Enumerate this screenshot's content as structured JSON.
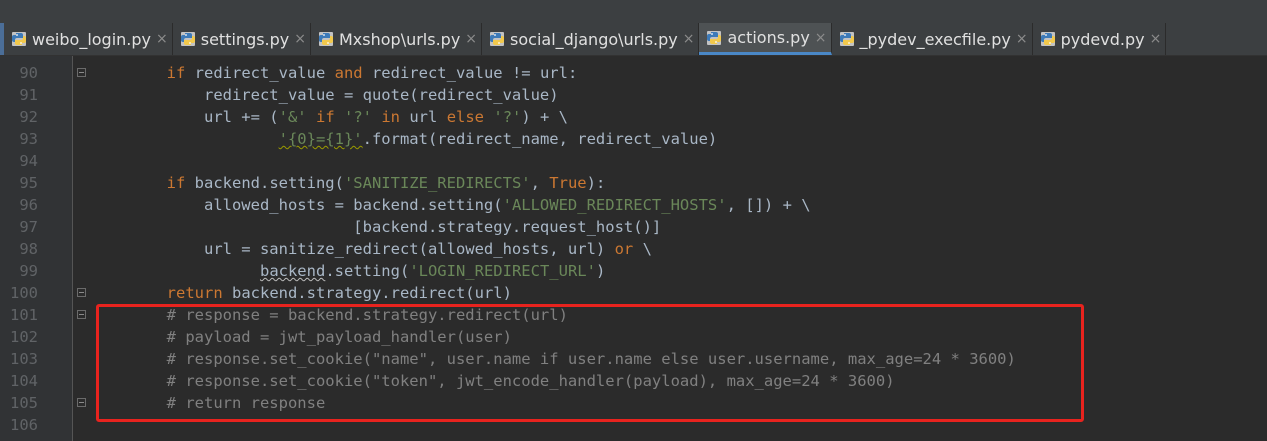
{
  "tabs": [
    {
      "label": "weibo_login.py",
      "active": false
    },
    {
      "label": "settings.py",
      "active": false
    },
    {
      "label": "Mxshop\\urls.py",
      "active": false
    },
    {
      "label": "social_django\\urls.py",
      "active": false
    },
    {
      "label": "actions.py",
      "active": true
    },
    {
      "label": "_pydev_execfile.py",
      "active": false
    },
    {
      "label": "pydevd.py",
      "active": false
    }
  ],
  "close_glyph": "×",
  "lines": [
    {
      "num": "90",
      "segs": [
        [
          "        ",
          ""
        ],
        [
          "if",
          "kw"
        ],
        [
          " redirect_value ",
          ""
        ],
        [
          "and",
          "kw"
        ],
        [
          " redirect_value != url:",
          ""
        ]
      ]
    },
    {
      "num": "91",
      "segs": [
        [
          "            redirect_value = quote(redirect_value)",
          ""
        ]
      ]
    },
    {
      "num": "92",
      "segs": [
        [
          "            url += (",
          ""
        ],
        [
          "'&'",
          "str"
        ],
        [
          " ",
          ""
        ],
        [
          "if",
          "kw"
        ],
        [
          " ",
          ""
        ],
        [
          "'?'",
          "str"
        ],
        [
          " ",
          ""
        ],
        [
          "in",
          "kw"
        ],
        [
          " url ",
          ""
        ],
        [
          "else",
          "kw"
        ],
        [
          " ",
          ""
        ],
        [
          "'?'",
          "str"
        ],
        [
          ") + \\",
          ""
        ]
      ]
    },
    {
      "num": "93",
      "segs": [
        [
          "                    ",
          ""
        ],
        [
          "'{0}={1}'",
          "str squig"
        ],
        [
          ".format(redirect_name, redirect_value)",
          ""
        ]
      ]
    },
    {
      "num": "94",
      "segs": [
        [
          "",
          ""
        ]
      ]
    },
    {
      "num": "95",
      "segs": [
        [
          "        ",
          ""
        ],
        [
          "if",
          "kw"
        ],
        [
          " backend.setting(",
          ""
        ],
        [
          "'SANITIZE_REDIRECTS'",
          "str"
        ],
        [
          ", ",
          ""
        ],
        [
          "True",
          "kw"
        ],
        [
          "):",
          ""
        ]
      ]
    },
    {
      "num": "96",
      "segs": [
        [
          "            allowed_hosts = backend.setting(",
          ""
        ],
        [
          "'ALLOWED_REDIRECT_HOSTS'",
          "str"
        ],
        [
          ", []) + \\",
          ""
        ]
      ]
    },
    {
      "num": "97",
      "segs": [
        [
          "                            [backend.strategy.request_host()]",
          ""
        ]
      ]
    },
    {
      "num": "98",
      "segs": [
        [
          "            url = sanitize_redirect(allowed_hosts, url) ",
          ""
        ],
        [
          "or",
          "kw"
        ],
        [
          " \\",
          ""
        ]
      ]
    },
    {
      "num": "99",
      "segs": [
        [
          "                  ",
          ""
        ],
        [
          "backend",
          "squig-dark"
        ],
        [
          ".setting(",
          ""
        ],
        [
          "'LOGIN_REDIRECT_URL'",
          "str"
        ],
        [
          ")",
          ""
        ]
      ]
    },
    {
      "num": "100",
      "segs": [
        [
          "        ",
          ""
        ],
        [
          "return",
          "kw"
        ],
        [
          " backend.strategy.redirect(url)",
          ""
        ]
      ]
    },
    {
      "num": "101",
      "segs": [
        [
          "        ",
          ""
        ],
        [
          "# response = backend.strategy.redirect(url)",
          "cm"
        ]
      ]
    },
    {
      "num": "102",
      "segs": [
        [
          "        ",
          ""
        ],
        [
          "# payload = jwt_payload_handler(user)",
          "cm"
        ]
      ]
    },
    {
      "num": "103",
      "segs": [
        [
          "        ",
          ""
        ],
        [
          "# response.set_cookie(\"name\", user.name if user.name else user.username, max_age=24 * 3600)",
          "cm"
        ]
      ]
    },
    {
      "num": "104",
      "segs": [
        [
          "        ",
          ""
        ],
        [
          "# response.set_cookie(\"token\", jwt_encode_handler(payload), max_age=24 * 3600)",
          "cm"
        ]
      ]
    },
    {
      "num": "105",
      "segs": [
        [
          "        ",
          ""
        ],
        [
          "# return response",
          "cm"
        ]
      ]
    },
    {
      "num": "106",
      "segs": [
        [
          "",
          ""
        ]
      ]
    }
  ],
  "colors": {
    "keyword": "#cc7832",
    "string": "#6a8759",
    "comment": "#808080",
    "text": "#a9b7c6",
    "highlight": "#e8231e"
  },
  "icons": {
    "tab": "python-file-icon",
    "fold": "fold-marker-icon"
  }
}
